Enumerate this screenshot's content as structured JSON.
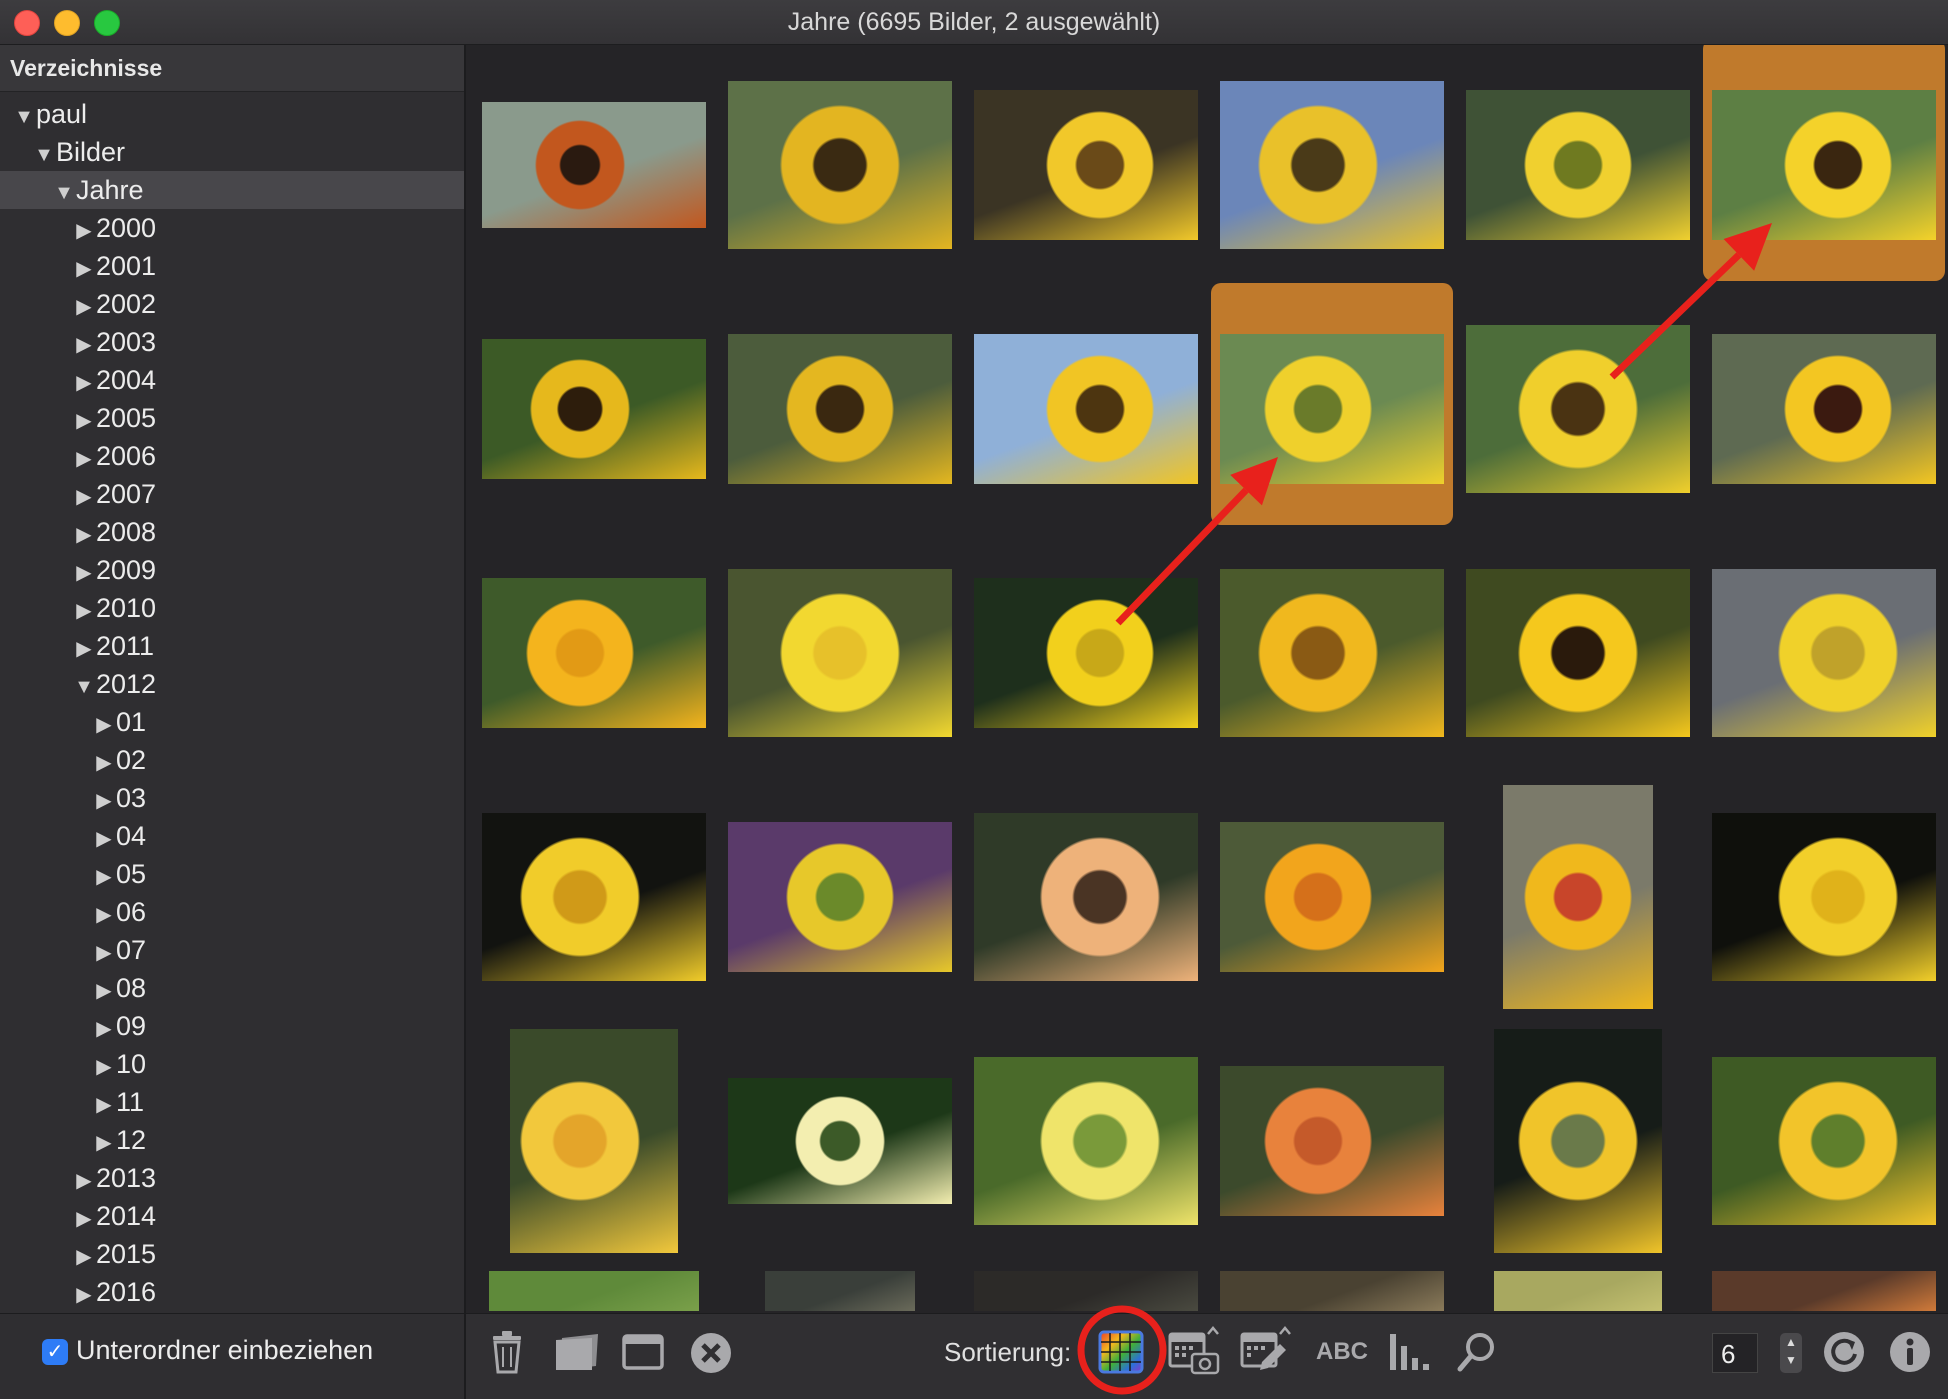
{
  "window": {
    "title": "Jahre (6695 Bilder, 2 ausgewählt)"
  },
  "sidebar": {
    "header": "Verzeichnisse",
    "tree": [
      {
        "label": "paul",
        "level": 0,
        "state": "expanded"
      },
      {
        "label": "Bilder",
        "level": 1,
        "state": "expanded"
      },
      {
        "label": "Jahre",
        "level": 2,
        "state": "expanded",
        "selected": true
      },
      {
        "label": "2000",
        "level": 3,
        "state": "collapsed"
      },
      {
        "label": "2001",
        "level": 3,
        "state": "collapsed"
      },
      {
        "label": "2002",
        "level": 3,
        "state": "collapsed"
      },
      {
        "label": "2003",
        "level": 3,
        "state": "collapsed"
      },
      {
        "label": "2004",
        "level": 3,
        "state": "collapsed"
      },
      {
        "label": "2005",
        "level": 3,
        "state": "collapsed"
      },
      {
        "label": "2006",
        "level": 3,
        "state": "collapsed"
      },
      {
        "label": "2007",
        "level": 3,
        "state": "collapsed"
      },
      {
        "label": "2008",
        "level": 3,
        "state": "collapsed"
      },
      {
        "label": "2009",
        "level": 3,
        "state": "collapsed"
      },
      {
        "label": "2010",
        "level": 3,
        "state": "collapsed"
      },
      {
        "label": "2011",
        "level": 3,
        "state": "collapsed"
      },
      {
        "label": "2012",
        "level": 3,
        "state": "expanded"
      },
      {
        "label": "01",
        "level": 4,
        "state": "collapsed"
      },
      {
        "label": "02",
        "level": 4,
        "state": "collapsed"
      },
      {
        "label": "03",
        "level": 4,
        "state": "collapsed"
      },
      {
        "label": "04",
        "level": 4,
        "state": "collapsed"
      },
      {
        "label": "05",
        "level": 4,
        "state": "collapsed"
      },
      {
        "label": "06",
        "level": 4,
        "state": "collapsed"
      },
      {
        "label": "07",
        "level": 4,
        "state": "collapsed"
      },
      {
        "label": "08",
        "level": 4,
        "state": "collapsed"
      },
      {
        "label": "09",
        "level": 4,
        "state": "collapsed"
      },
      {
        "label": "10",
        "level": 4,
        "state": "collapsed"
      },
      {
        "label": "11",
        "level": 4,
        "state": "collapsed"
      },
      {
        "label": "12",
        "level": 4,
        "state": "collapsed"
      },
      {
        "label": "2013",
        "level": 3,
        "state": "collapsed"
      },
      {
        "label": "2014",
        "level": 3,
        "state": "collapsed"
      },
      {
        "label": "2015",
        "level": 3,
        "state": "collapsed"
      },
      {
        "label": "2016",
        "level": 3,
        "state": "collapsed"
      }
    ],
    "include_subfolders": {
      "label": "Unterordner einbeziehen",
      "checked": true
    }
  },
  "grid": {
    "columns": 6,
    "selected_count": 2,
    "thumbnails": [
      {
        "subject": "orange-sunflower-lake",
        "colors": [
          "#8a9a8c",
          "#c2571e",
          "#2a1a10"
        ],
        "selected": false
      },
      {
        "subject": "sunflower-field",
        "colors": [
          "#5d7148",
          "#e3b521",
          "#3a2a12"
        ],
        "selected": false
      },
      {
        "subject": "sunflower-backlit-sunset",
        "colors": [
          "#3b3424",
          "#f1c82a",
          "#6a4a18"
        ],
        "selected": false
      },
      {
        "subject": "sunflower-field-sky",
        "colors": [
          "#6b86b9",
          "#e9c12a",
          "#4a3a18"
        ],
        "selected": false
      },
      {
        "subject": "sunflower-closeup",
        "colors": [
          "#3f5236",
          "#f0d02f",
          "#6f7a20"
        ],
        "selected": false
      },
      {
        "subject": "sunflower-macro",
        "colors": [
          "#5d7f44",
          "#f4d22a",
          "#3a2610"
        ],
        "selected": true
      },
      {
        "subject": "sunflower-meadow",
        "colors": [
          "#3c5a26",
          "#e6b81c",
          "#2d1d0c"
        ],
        "selected": false
      },
      {
        "subject": "sunflowers-garden",
        "colors": [
          "#4c5c3c",
          "#e4b720",
          "#3a2810"
        ],
        "selected": false
      },
      {
        "subject": "sunflowers-blue-sky",
        "colors": [
          "#8fb0d8",
          "#f1c524",
          "#4d3510"
        ],
        "selected": false
      },
      {
        "subject": "sunflower-on-bag",
        "colors": [
          "#6b8a52",
          "#efd02c",
          "#6a7b2a"
        ],
        "selected": true
      },
      {
        "subject": "sunflower-leaves",
        "colors": [
          "#4d6d3a",
          "#f0cf2c",
          "#4a3312"
        ],
        "selected": false
      },
      {
        "subject": "rudbeckia-yellow",
        "colors": [
          "#5e6a52",
          "#f3c622",
          "#3b1a10"
        ],
        "selected": false
      },
      {
        "subject": "marigold",
        "colors": [
          "#3e5a2a",
          "#f4b41d",
          "#e29a15"
        ],
        "selected": false
      },
      {
        "subject": "yellow-poppy",
        "colors": [
          "#4a5530",
          "#f2d830",
          "#e7c12a"
        ],
        "selected": false
      },
      {
        "subject": "dandelion-bee",
        "colors": [
          "#1e2f1c",
          "#f2d01c",
          "#c8a818"
        ],
        "selected": false
      },
      {
        "subject": "coreopsis",
        "colors": [
          "#4b5a2c",
          "#f0b81e",
          "#8a5a14"
        ],
        "selected": false
      },
      {
        "subject": "yellow-tulips",
        "colors": [
          "#3f4a20",
          "#f5c81d",
          "#2a1a0c"
        ],
        "selected": false
      },
      {
        "subject": "yellow-flower-stone",
        "colors": [
          "#6a6e74",
          "#f0d12a",
          "#c0a22a"
        ],
        "selected": false
      },
      {
        "subject": "yellow-poppy-dark",
        "colors": [
          "#121310",
          "#f1cc2a",
          "#d09a18"
        ],
        "selected": false
      },
      {
        "subject": "flower-bed-purple-yellow",
        "colors": [
          "#5a3a6a",
          "#e7c82a",
          "#6b8a2a"
        ],
        "selected": false
      },
      {
        "subject": "peach-osteospermum",
        "colors": [
          "#2f3a28",
          "#eeb27a",
          "#4a3424"
        ],
        "selected": false
      },
      {
        "subject": "orange-cosmos",
        "colors": [
          "#4d5a38",
          "#f2a51c",
          "#d5701a"
        ],
        "selected": false
      },
      {
        "subject": "yellow-tulip-red",
        "colors": [
          "#7b7a6a",
          "#f0b81c",
          "#c8452a"
        ],
        "selected": false
      },
      {
        "subject": "yellow-poppy-black",
        "colors": [
          "#0f100c",
          "#f2cf2a",
          "#e0b21a"
        ],
        "selected": false
      },
      {
        "subject": "yellow-rose",
        "colors": [
          "#3a4a2a",
          "#f2c83c",
          "#e4a52a"
        ],
        "selected": false
      },
      {
        "subject": "white-bellflower",
        "colors": [
          "#1d3818",
          "#f3eeb0",
          "#3c5a28"
        ],
        "selected": false
      },
      {
        "subject": "oxalis-grass",
        "colors": [
          "#4a6a2a",
          "#efe46a",
          "#7a9a3a"
        ],
        "selected": false
      },
      {
        "subject": "orange-lily",
        "colors": [
          "#3c4a2c",
          "#e8823c",
          "#c55a2a"
        ],
        "selected": false
      },
      {
        "subject": "yellow-tulip-grass",
        "colors": [
          "#161c18",
          "#f0c42a",
          "#6a7a4a"
        ],
        "selected": false
      },
      {
        "subject": "yellow-shrub-flowers",
        "colors": [
          "#3e5a24",
          "#f2c42a",
          "#5f7f2c"
        ],
        "selected": false
      },
      {
        "subject": "lawn-partial",
        "colors": [
          "#5f8a3a",
          "#7aa04a",
          "#4a2a2a"
        ],
        "selected": false
      },
      {
        "subject": "market-partial",
        "colors": [
          "#3a3f3a",
          "#6a6a5a",
          "#2a2a2a"
        ],
        "selected": false
      },
      {
        "subject": "partial-3",
        "colors": [
          "#2c2a28",
          "#4a4a40",
          "#2a2826"
        ],
        "selected": false
      },
      {
        "subject": "partial-4",
        "colors": [
          "#4a4232",
          "#8a7a5a",
          "#3a3428"
        ],
        "selected": false
      },
      {
        "subject": "partial-5",
        "colors": [
          "#a8a860",
          "#c4c070",
          "#8a8a4a"
        ],
        "selected": false
      },
      {
        "subject": "partial-6",
        "colors": [
          "#5a3a2a",
          "#d07a3a",
          "#2a2420"
        ],
        "selected": false
      }
    ]
  },
  "toolbar": {
    "buttons": [
      "trash-icon",
      "album-icon",
      "window-icon",
      "close-circle-icon"
    ],
    "sort_label": "Sortierung:",
    "sort_buttons": [
      "sort-color-icon",
      "sort-date-taken-icon",
      "sort-date-modified-icon",
      "sort-name-icon",
      "sort-rating-icon"
    ],
    "sort_name_text": "ABC",
    "zoom_value": "6",
    "right_buttons": [
      "refresh-icon",
      "info-icon"
    ]
  },
  "annotations": {
    "arrow_color": "#e8211c",
    "circle_color": "#e8211c",
    "circled": "sort-color-icon"
  }
}
